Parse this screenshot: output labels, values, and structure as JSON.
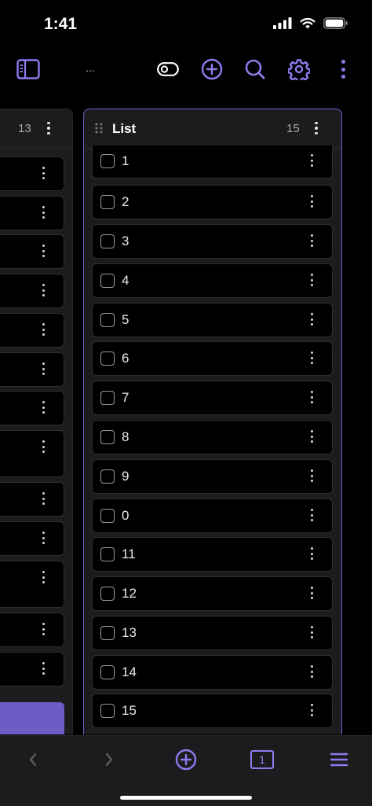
{
  "status_bar": {
    "time": "1:41"
  },
  "toolbar": {
    "title": "..."
  },
  "board": {
    "left_lane": {
      "count": "13"
    },
    "right_lane": {
      "title": "List",
      "count": "15",
      "items": [
        "1",
        "2",
        "3",
        "4",
        "5",
        "6",
        "7",
        "8",
        "9",
        "0",
        "11",
        "12",
        "13",
        "14",
        "15"
      ]
    }
  },
  "bottom_nav": {
    "tab_count": "1"
  },
  "colors": {
    "accent": "#8b7cf0",
    "lane_border": "#6d5fd0",
    "add_button": "#6e5cc6",
    "background": "#000000",
    "lane_bg": "#1c1c1e"
  },
  "icons": [
    "sidebar-toggle-icon",
    "toggle-switch-icon",
    "add-circle-icon",
    "search-icon",
    "gear-icon",
    "more-vertical-icon",
    "drag-handle-icon",
    "back-arrow-icon",
    "forward-arrow-icon",
    "tabs-icon",
    "menu-icon"
  ]
}
